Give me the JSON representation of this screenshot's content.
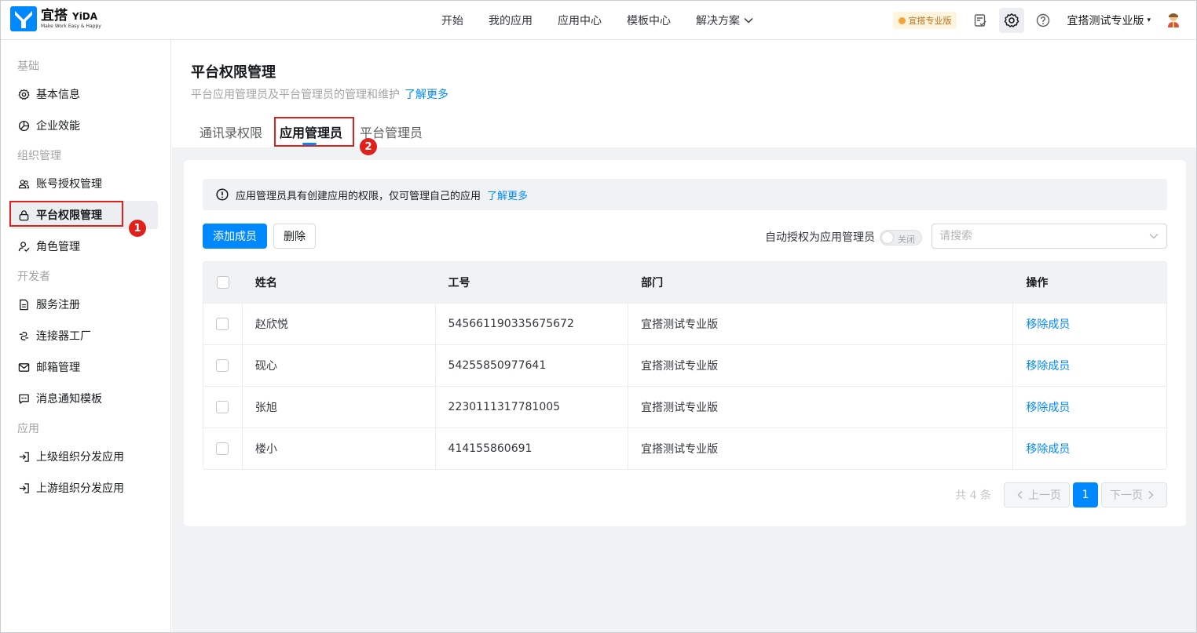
{
  "brand": {
    "name": "宜搭",
    "name_en": "YiDA",
    "slogan": "Make Work Easy & Happy",
    "color": "#0089ff"
  },
  "nav": {
    "items": [
      {
        "label": "开始"
      },
      {
        "label": "我的应用"
      },
      {
        "label": "应用中心"
      },
      {
        "label": "模板中心"
      },
      {
        "label": "解决方案",
        "has_dropdown": true
      }
    ]
  },
  "header_tools": {
    "pro_badge": "宜搭专业版",
    "icons": [
      "checklist-icon",
      "settings-icon",
      "help-icon"
    ],
    "org_name": "宜搭测试专业版",
    "avatar_icon": "user-avatar"
  },
  "sidebar": {
    "groups": [
      {
        "label": "基础",
        "items": [
          {
            "label": "基本信息",
            "icon": "gear-icon"
          },
          {
            "label": "企业效能",
            "icon": "pie-chart-icon"
          }
        ]
      },
      {
        "label": "组织管理",
        "items": [
          {
            "label": "账号授权管理",
            "icon": "users-icon"
          },
          {
            "label": "平台权限管理",
            "icon": "lock-icon",
            "active": true
          },
          {
            "label": "角色管理",
            "icon": "user-check-icon"
          }
        ]
      },
      {
        "label": "开发者",
        "items": [
          {
            "label": "服务注册",
            "icon": "document-icon"
          },
          {
            "label": "连接器工厂",
            "icon": "connector-icon"
          },
          {
            "label": "邮箱管理",
            "icon": "mail-icon"
          },
          {
            "label": "消息通知模板",
            "icon": "message-icon"
          }
        ]
      },
      {
        "label": "应用",
        "items": [
          {
            "label": "上级组织分发应用",
            "icon": "import-icon"
          },
          {
            "label": "上游组织分发应用",
            "icon": "import-icon"
          }
        ]
      }
    ]
  },
  "annotations": {
    "step1": "1",
    "step2": "2",
    "highlight_color": "#e0201b"
  },
  "page": {
    "title": "平台权限管理",
    "description": "平台应用管理员及平台管理员的管理和维护",
    "learn_more": "了解更多",
    "tabs": [
      {
        "label": "通讯录权限"
      },
      {
        "label": "应用管理员",
        "active": true
      },
      {
        "label": "平台管理员"
      }
    ]
  },
  "panel": {
    "notice_text": "应用管理员具有创建应用的权限，仅可管理自己的应用",
    "notice_link": "了解更多",
    "add_button": "添加成员",
    "delete_button": "删除",
    "auto_grant_label": "自动授权为应用管理员",
    "switch_state": "关闭",
    "search_placeholder": "请搜索"
  },
  "table": {
    "columns": [
      "姓名",
      "工号",
      "部门",
      "操作"
    ],
    "rows": [
      {
        "name": "赵欣悦",
        "id": "545661190335675672",
        "dept": "宜搭测试专业版",
        "action": "移除成员"
      },
      {
        "name": "砚心",
        "id": "54255850977641",
        "dept": "宜搭测试专业版",
        "action": "移除成员"
      },
      {
        "name": "张旭",
        "id": "2230111317781005",
        "dept": "宜搭测试专业版",
        "action": "移除成员"
      },
      {
        "name": "楼小",
        "id": "414155860691",
        "dept": "宜搭测试专业版",
        "action": "移除成员"
      }
    ]
  },
  "pagination": {
    "total": "共 4 条",
    "prev": "上一页",
    "current": "1",
    "next": "下一页"
  }
}
